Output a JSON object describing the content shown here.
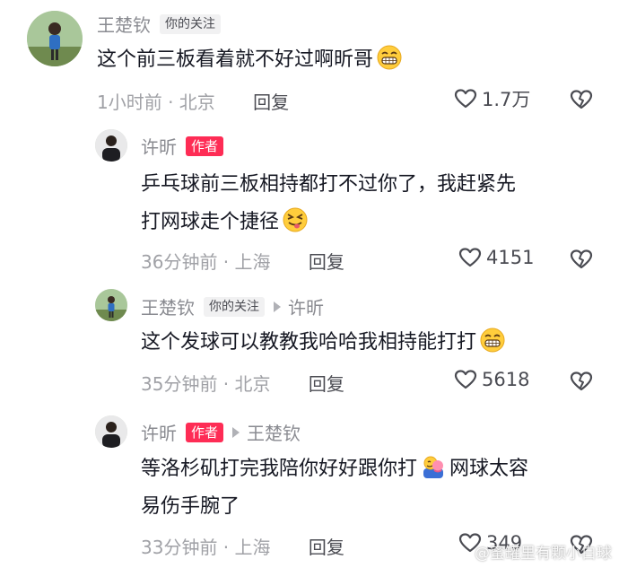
{
  "comments": [
    {
      "username": "王楚钦",
      "badge": "你的关注",
      "text": "这个前三板看着就不好过啊昕哥",
      "emoji": "grin-emoji",
      "time_location": "1小时前 · 北京",
      "reply_label": "回复",
      "likes": "1.7万"
    },
    {
      "username": "许昕",
      "badge": "作者",
      "text_line1": "乒乓球前三板相持都打不过你了，我赶紧先",
      "text_line2": "打网球走个捷径",
      "emoji": "squint-tongue-emoji",
      "time_location": "36分钟前 · 上海",
      "reply_label": "回复",
      "likes": "4151"
    },
    {
      "username": "王楚钦",
      "badge": "你的关注",
      "reply_to": "许昕",
      "text": "这个发球可以教教我哈哈我相持能打打",
      "emoji": "grin-emoji",
      "time_location": "35分钟前 · 北京",
      "reply_label": "回复",
      "likes": "5618"
    },
    {
      "username": "许昕",
      "badge": "作者",
      "reply_to": "王楚钦",
      "text_line1a": "等洛杉矶打完我陪你好好跟你打",
      "emoji": "hug-emoji",
      "text_line1b": "网球太容",
      "text_line2": "易伤手腕了",
      "time_location": "33分钟前 · 上海",
      "reply_label": "回复",
      "likes": "349"
    }
  ],
  "watermark": "@蜜罐里有颗小白球",
  "colors": {
    "author_badge": "#fe2c55",
    "follow_badge_bg": "#f1f1f2",
    "name": "#8a8b91",
    "text": "#161823",
    "meta": "#a0a1a6"
  }
}
